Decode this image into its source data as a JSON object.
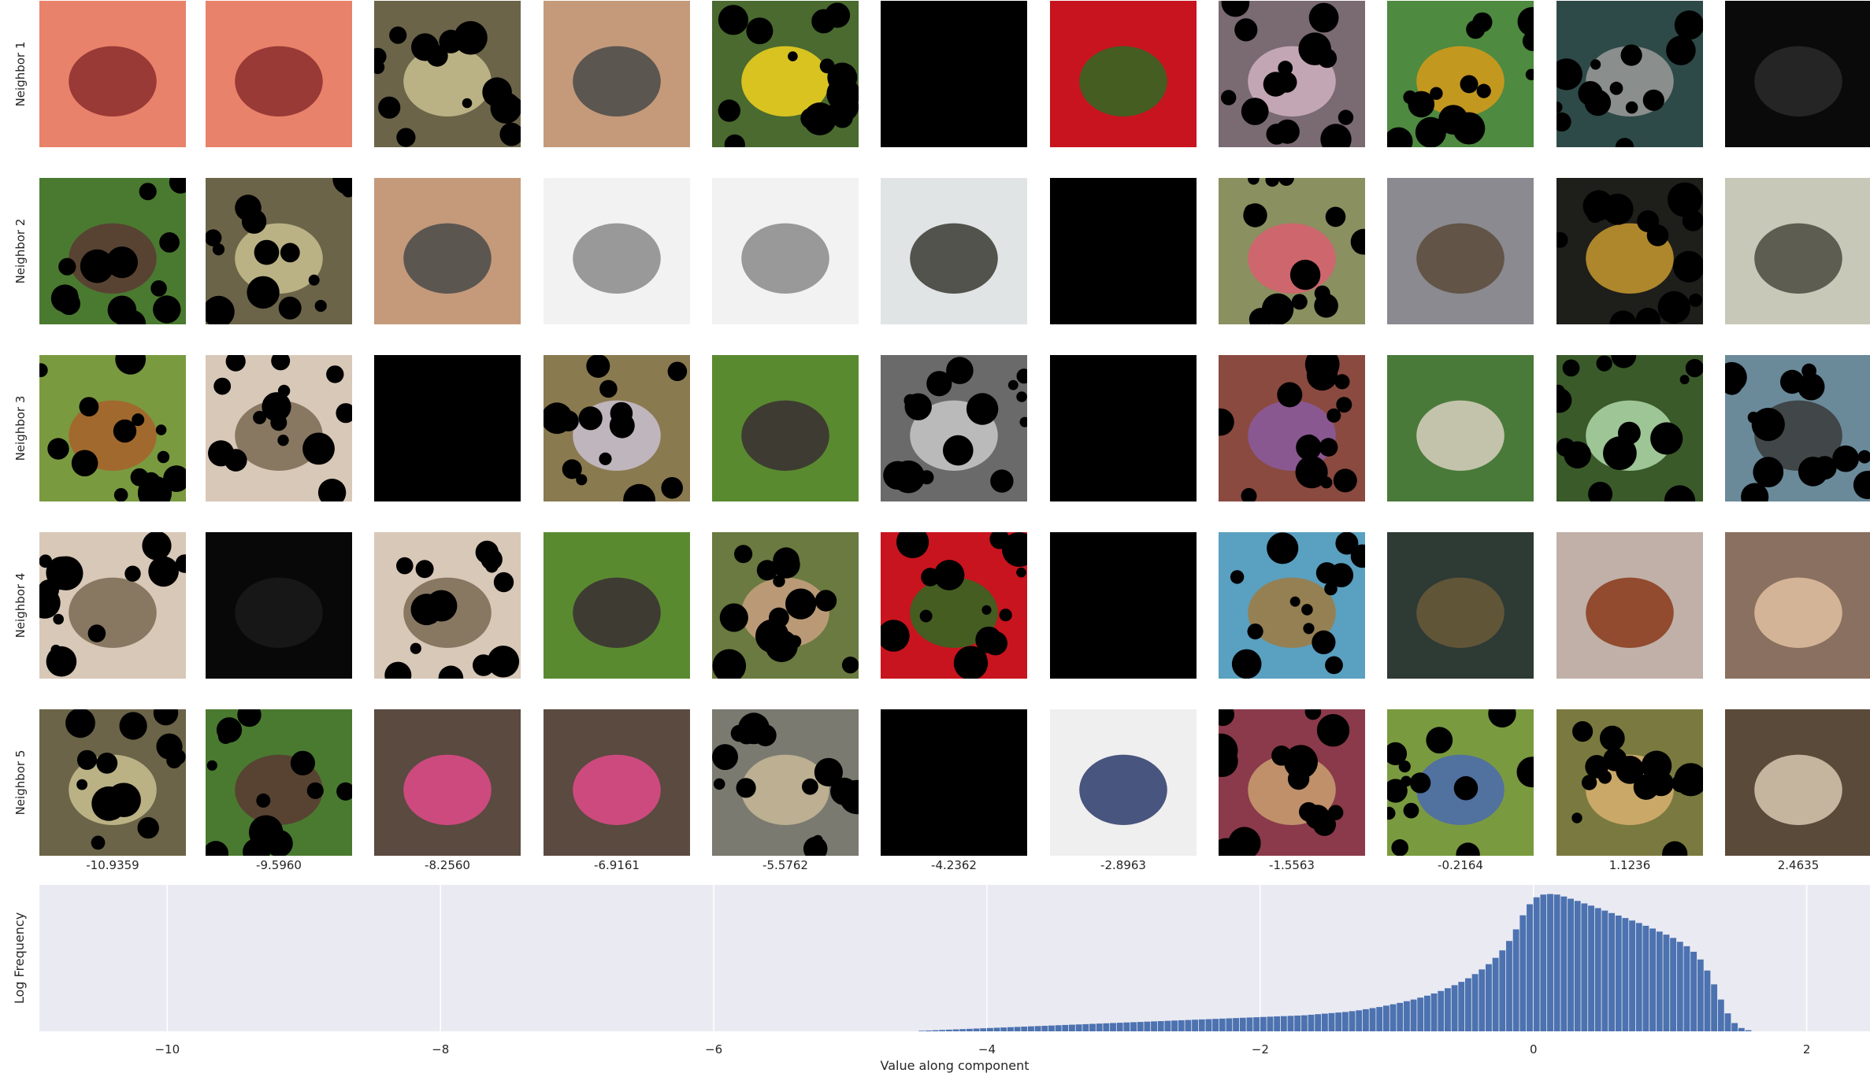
{
  "row_labels": [
    "Neighbor 1",
    "Neighbor 2",
    "Neighbor 3",
    "Neighbor 4",
    "Neighbor 5"
  ],
  "column_values": [
    "-10.9359",
    "-9.5960",
    "-8.2560",
    "-6.9161",
    "-5.5762",
    "-4.2362",
    "-2.8963",
    "-1.5563",
    "-0.2164",
    "1.1236",
    "2.4635"
  ],
  "thumbnails": [
    [
      {
        "icon": "orange-floral-bag-photo",
        "bg": "#e8826a",
        "accent": "#8b2e2e",
        "mask": false
      },
      {
        "icon": "orange-floral-bag-photo",
        "bg": "#e8826a",
        "accent": "#8b2e2e",
        "mask": false
      },
      {
        "icon": "metal-grate-photo",
        "bg": "#6b6448",
        "accent": "#c8bf90",
        "mask": true
      },
      {
        "icon": "sea-lion-pup-photo",
        "bg": "#c49a7a",
        "accent": "#4a4a4a",
        "mask": false
      },
      {
        "icon": "yellow-flower-photo",
        "bg": "#4a6a30",
        "accent": "#f2d21e",
        "mask": true
      },
      {
        "icon": "black-image",
        "bg": "#000000",
        "accent": "#000000",
        "mask": false
      },
      {
        "icon": "strawberries-photo",
        "bg": "#c8141e",
        "accent": "#2e6a22",
        "mask": false
      },
      {
        "icon": "masked-interior-photo",
        "bg": "#7a6a72",
        "accent": "#d0b0c0",
        "mask": true
      },
      {
        "icon": "snake-on-leaf-photo",
        "bg": "#4e8a40",
        "accent": "#d89a1a",
        "mask": true
      },
      {
        "icon": "beaver-in-water-photo",
        "bg": "#2e4a48",
        "accent": "#9a9a9a",
        "mask": true
      },
      {
        "icon": "dark-masked-photo",
        "bg": "#0a0a0a",
        "accent": "#2a2a2a",
        "mask": false
      }
    ],
    [
      {
        "icon": "brown-dog-grass-photo",
        "bg": "#4a7a30",
        "accent": "#5a3a32",
        "mask": true
      },
      {
        "icon": "metal-grate-photo",
        "bg": "#6b6448",
        "accent": "#c8bf90",
        "mask": true
      },
      {
        "icon": "sea-lion-pup-photo",
        "bg": "#c49a7a",
        "accent": "#4a4a4a",
        "mask": false
      },
      {
        "icon": "led-bulb-photo",
        "bg": "#f2f2f2",
        "accent": "#8a8a8a",
        "mask": false
      },
      {
        "icon": "led-bulb-photo",
        "bg": "#f2f2f2",
        "accent": "#8a8a8a",
        "mask": false
      },
      {
        "icon": "metal-clip-photo",
        "bg": "#e0e4e4",
        "accent": "#3a3a32",
        "mask": false
      },
      {
        "icon": "black-image",
        "bg": "#000000",
        "accent": "#000000",
        "mask": false
      },
      {
        "icon": "flower-bouquet-photo",
        "bg": "#8a9060",
        "accent": "#d86070",
        "mask": true
      },
      {
        "icon": "snake-on-rock-photo",
        "bg": "#8a8a90",
        "accent": "#5a4a3a",
        "mask": false
      },
      {
        "icon": "dark-glitter-photo",
        "bg": "#1e1e1a",
        "accent": "#c89a30",
        "mask": true
      },
      {
        "icon": "gray-monkey-photo",
        "bg": "#c8c8b8",
        "accent": "#4a4a40",
        "mask": false
      }
    ],
    [
      {
        "icon": "two-dogs-photo",
        "bg": "#7a9a40",
        "accent": "#a8602a",
        "mask": true
      },
      {
        "icon": "terrier-photo",
        "bg": "#d8c8b8",
        "accent": "#7a6a52",
        "mask": true
      },
      {
        "icon": "black-image",
        "bg": "#000000",
        "accent": "#000000",
        "mask": false
      },
      {
        "icon": "masked-scene-photo",
        "bg": "#8a7a50",
        "accent": "#c8c0d0",
        "mask": true
      },
      {
        "icon": "corgi-on-grass-photo",
        "bg": "#5a8a30",
        "accent": "#3a2e32",
        "mask": false
      },
      {
        "icon": "gray-masked-photo",
        "bg": "#6a6a6a",
        "accent": "#c8c8c8",
        "mask": true
      },
      {
        "icon": "black-image",
        "bg": "#000000",
        "accent": "#000000",
        "mask": false
      },
      {
        "icon": "birdhouse-photo",
        "bg": "#8a4a40",
        "accent": "#8a5aa0",
        "mask": true
      },
      {
        "icon": "bird-on-branch-photo",
        "bg": "#4a7a3a",
        "accent": "#d8d0c0",
        "mask": false
      },
      {
        "icon": "cabbage-photo",
        "bg": "#3a5a2a",
        "accent": "#b0d8a8",
        "mask": true
      },
      {
        "icon": "keeshond-dog-photo",
        "bg": "#6a8a9a",
        "accent": "#3a3a3a",
        "mask": true
      }
    ],
    [
      {
        "icon": "terrier-photo",
        "bg": "#d8c8b8",
        "accent": "#7a6a52",
        "mask": true
      },
      {
        "icon": "dark-masked-photo",
        "bg": "#080808",
        "accent": "#1a1a1a",
        "mask": false
      },
      {
        "icon": "terrier-photo",
        "bg": "#d8c8b8",
        "accent": "#7a6a52",
        "mask": true
      },
      {
        "icon": "corgi-on-grass-photo",
        "bg": "#5a8a30",
        "accent": "#3a2e32",
        "mask": false
      },
      {
        "icon": "dogs-in-field-photo",
        "bg": "#6a7a40",
        "accent": "#c8a080",
        "mask": true
      },
      {
        "icon": "strawberries-photo",
        "bg": "#c8141e",
        "accent": "#2e6a22",
        "mask": true
      },
      {
        "icon": "black-image",
        "bg": "#000000",
        "accent": "#000000",
        "mask": false
      },
      {
        "icon": "beach-hut-photo",
        "bg": "#5aa0c0",
        "accent": "#a07a40",
        "mask": true
      },
      {
        "icon": "dark-stick-photo",
        "bg": "#2e3a34",
        "accent": "#6a5a3a",
        "mask": false
      },
      {
        "icon": "papillon-dog-photo",
        "bg": "#c0b0a8",
        "accent": "#8a3a1a",
        "mask": false
      },
      {
        "icon": "spaniel-face-photo",
        "bg": "#8a7060",
        "accent": "#e0c0a0",
        "mask": false
      }
    ],
    [
      {
        "icon": "metal-grate-photo",
        "bg": "#6b6448",
        "accent": "#c8bf90",
        "mask": true
      },
      {
        "icon": "brown-dog-grass-photo",
        "bg": "#4a7a30",
        "accent": "#5a3a32",
        "mask": true
      },
      {
        "icon": "schnauzer-photo",
        "bg": "#5a4a40",
        "accent": "#e04a8a",
        "mask": false
      },
      {
        "icon": "schnauzer-photo",
        "bg": "#5a4a40",
        "accent": "#e04a8a",
        "mask": false
      },
      {
        "icon": "animal-in-water-photo",
        "bg": "#7a7a70",
        "accent": "#c8b898",
        "mask": true
      },
      {
        "icon": "black-image",
        "bg": "#000000",
        "accent": "#000000",
        "mask": false
      },
      {
        "icon": "blimp-in-sky-photo",
        "bg": "#efefef",
        "accent": "#2a3a6a",
        "mask": false
      },
      {
        "icon": "red-sweater-photo",
        "bg": "#8a3a4a",
        "accent": "#c8a070",
        "mask": true
      },
      {
        "icon": "dragonfly-on-leaf-photo",
        "bg": "#7a9a40",
        "accent": "#4a6ab0",
        "mask": true
      },
      {
        "icon": "lion-cub-photo",
        "bg": "#7a7a40",
        "accent": "#d8b070",
        "mask": true
      },
      {
        "icon": "poodle-photo",
        "bg": "#5a4a3a",
        "accent": "#d8c8b0",
        "mask": false
      }
    ]
  ],
  "chart_data": {
    "type": "bar",
    "title": "",
    "xlabel": "Value along component",
    "ylabel": "Log Frequency",
    "xlim": [
      -10.9359,
      2.4635
    ],
    "xticks": [
      -10,
      -8,
      -6,
      -4,
      -2,
      0,
      2
    ],
    "xtick_labels": [
      "−10",
      "−8",
      "−6",
      "−4",
      "−2",
      "0",
      "2"
    ],
    "ylim": [
      0,
      5.3
    ],
    "grid": true,
    "bar_color": "#4c72b0",
    "axes_facecolor": "#eaeaf2",
    "bins": {
      "start": -4.5,
      "width": 0.05,
      "log_counts": [
        0.02,
        0.03,
        0.04,
        0.05,
        0.06,
        0.07,
        0.08,
        0.09,
        0.1,
        0.11,
        0.12,
        0.13,
        0.14,
        0.15,
        0.16,
        0.17,
        0.18,
        0.19,
        0.2,
        0.21,
        0.22,
        0.23,
        0.24,
        0.25,
        0.26,
        0.27,
        0.28,
        0.29,
        0.3,
        0.31,
        0.32,
        0.33,
        0.34,
        0.35,
        0.36,
        0.37,
        0.38,
        0.39,
        0.4,
        0.41,
        0.42,
        0.43,
        0.44,
        0.45,
        0.46,
        0.47,
        0.48,
        0.49,
        0.5,
        0.51,
        0.52,
        0.53,
        0.54,
        0.55,
        0.56,
        0.57,
        0.58,
        0.6,
        0.62,
        0.64,
        0.66,
        0.68,
        0.7,
        0.73,
        0.76,
        0.8,
        0.84,
        0.88,
        0.93,
        0.98,
        1.03,
        1.09,
        1.15,
        1.22,
        1.29,
        1.37,
        1.46,
        1.56,
        1.67,
        1.79,
        1.92,
        2.07,
        2.24,
        2.43,
        2.66,
        2.93,
        3.27,
        3.69,
        4.2,
        4.6,
        4.85,
        4.95,
        4.97,
        4.95,
        4.88,
        4.8,
        4.72,
        4.63,
        4.55,
        4.46,
        4.37,
        4.28,
        4.19,
        4.1,
        4.01,
        3.92,
        3.82,
        3.72,
        3.61,
        3.5,
        3.38,
        3.24,
        3.08,
        2.88,
        2.6,
        2.2,
        1.7,
        1.15,
        0.65,
        0.3,
        0.12,
        0.04
      ]
    }
  }
}
